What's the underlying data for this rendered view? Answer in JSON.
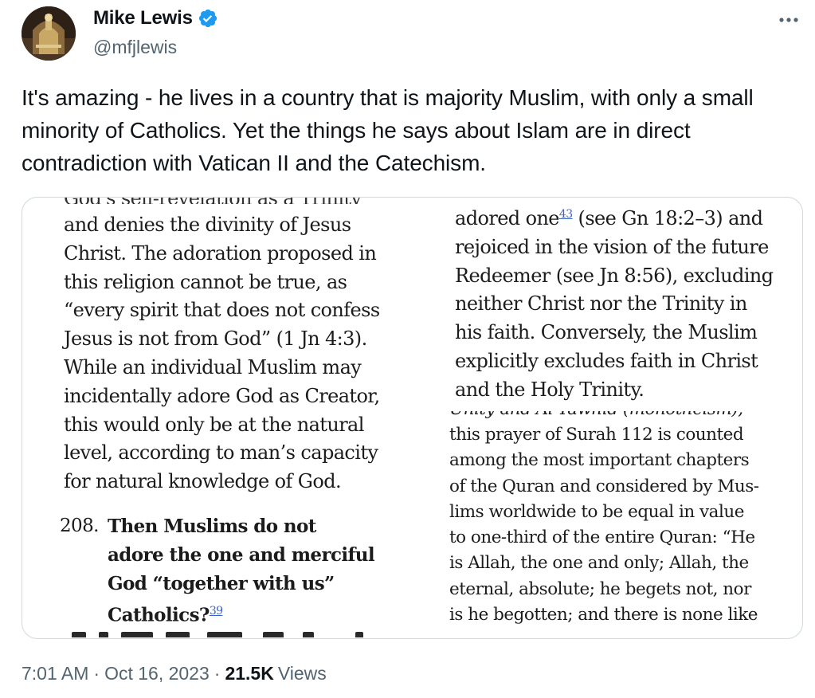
{
  "tweet": {
    "author": {
      "display_name": "Mike Lewis",
      "handle": "@mfjlewis",
      "verified": true
    },
    "text": "It's amazing - he lives in a country that is majority Muslim, with only a small minority of Catholics. Yet the things he says about Islam are in direct contradiction with Vatican II and the Catechism.",
    "meta": {
      "time": "7:01 AM",
      "separator": "·",
      "date": "Oct 16, 2023",
      "views_count": "21.5K",
      "views_label": "Views"
    },
    "more_icon": "more-dots-icon",
    "verified_icon": "verified-badge-icon"
  },
  "media": {
    "left_column": {
      "cut_top": "God's self-revelation as a Trinity",
      "lines": [
        "and denies the divinity of Jesus",
        "Christ. The adoration proposed in",
        "this religion cannot be true, as",
        "“every spirit that does not confess",
        "Jesus is not from God” (1 Jn 4:3).",
        "While an individual Muslim may",
        "incidentally adore God as Creator,",
        "this would only be at the natural",
        "level, according to man’s capacity",
        "for natural knowledge of God."
      ],
      "question_number": "208.",
      "question_lines": [
        "Then Muslims do not",
        "adore the one and merciful",
        "God “together with us”",
        "Catholics?"
      ],
      "question_footnote": "39"
    },
    "right_column_top": {
      "first_line_prefix": "adored one",
      "first_line_footnote": "43",
      "first_line_suffix": " (see Gn 18:2–3) and",
      "lines": [
        "rejoiced in the vision of the future",
        "Redeemer (see Jn 8:56), excluding",
        "neither Christ nor the Trinity in",
        "his faith. Conversely, the Muslim",
        "explicitly excludes faith in Christ",
        "and the Holy Trinity."
      ]
    },
    "right_column_bottom": {
      "cut_top": "Unity and Al-Tawhid (monotheism),",
      "lines": [
        "this prayer of Surah 112 is counted",
        "among the most important chapters",
        "of the Quran and considered by Mus-",
        "lims worldwide to be equal in value",
        "to one-third of the entire Quran: “He",
        "is Allah, the one and only; Allah, the",
        "eternal, absolute; he begets not, nor",
        "is he begotten; and there is none like"
      ]
    }
  },
  "colors": {
    "text_primary": "#0f1419",
    "text_secondary": "#536471",
    "verified_blue": "#1d9bf0",
    "border": "#cfd9de",
    "footnote_link": "#3b63c4"
  }
}
